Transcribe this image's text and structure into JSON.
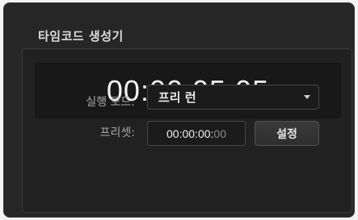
{
  "panel": {
    "title": "타임코드 생성기"
  },
  "timecode": {
    "display": "00:00:05:05"
  },
  "run_mode": {
    "label": "실행 모드:",
    "selected": "프리 런"
  },
  "preset": {
    "label": "프리셋:",
    "value_main": "00:00:00:",
    "value_frames": "00",
    "set_label": "설정"
  },
  "colors": {
    "panel_bg": "#262626",
    "display_bg": "#181818",
    "text": "#f2f2f2",
    "label": "#a8a8a8"
  }
}
